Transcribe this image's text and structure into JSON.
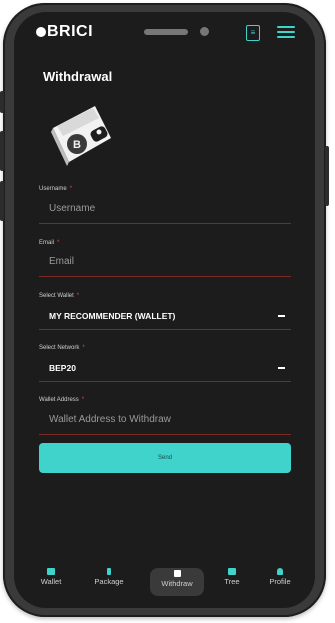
{
  "app": {
    "logo_text": "BRICI"
  },
  "page": {
    "title": "Withdrawal"
  },
  "form": {
    "username": {
      "label": "Username",
      "placeholder": "Username"
    },
    "email": {
      "label": "Email",
      "placeholder": "Email"
    },
    "wallet": {
      "label": "Select Wallet",
      "value": "MY RECOMMENDER (WALLET)"
    },
    "network": {
      "label": "Select Network",
      "value": "BEP20"
    },
    "address": {
      "label": "Wallet Address",
      "placeholder": "Wallet Address to Withdraw"
    },
    "required_mark": "*",
    "send_label": "Send"
  },
  "nav": {
    "items": [
      {
        "label": "Wallet",
        "icon": "wallet-icon"
      },
      {
        "label": "Package",
        "icon": "package-icon"
      },
      {
        "label": "Withdraw",
        "icon": "withdraw-icon"
      },
      {
        "label": "Tree",
        "icon": "tree-icon"
      },
      {
        "label": "Profile",
        "icon": "profile-icon"
      }
    ],
    "active": "Withdraw"
  },
  "colors": {
    "accent": "#3fd3cc",
    "background": "#1c1c1c",
    "required": "#e0533a",
    "field_underline": "#7a2a23"
  }
}
